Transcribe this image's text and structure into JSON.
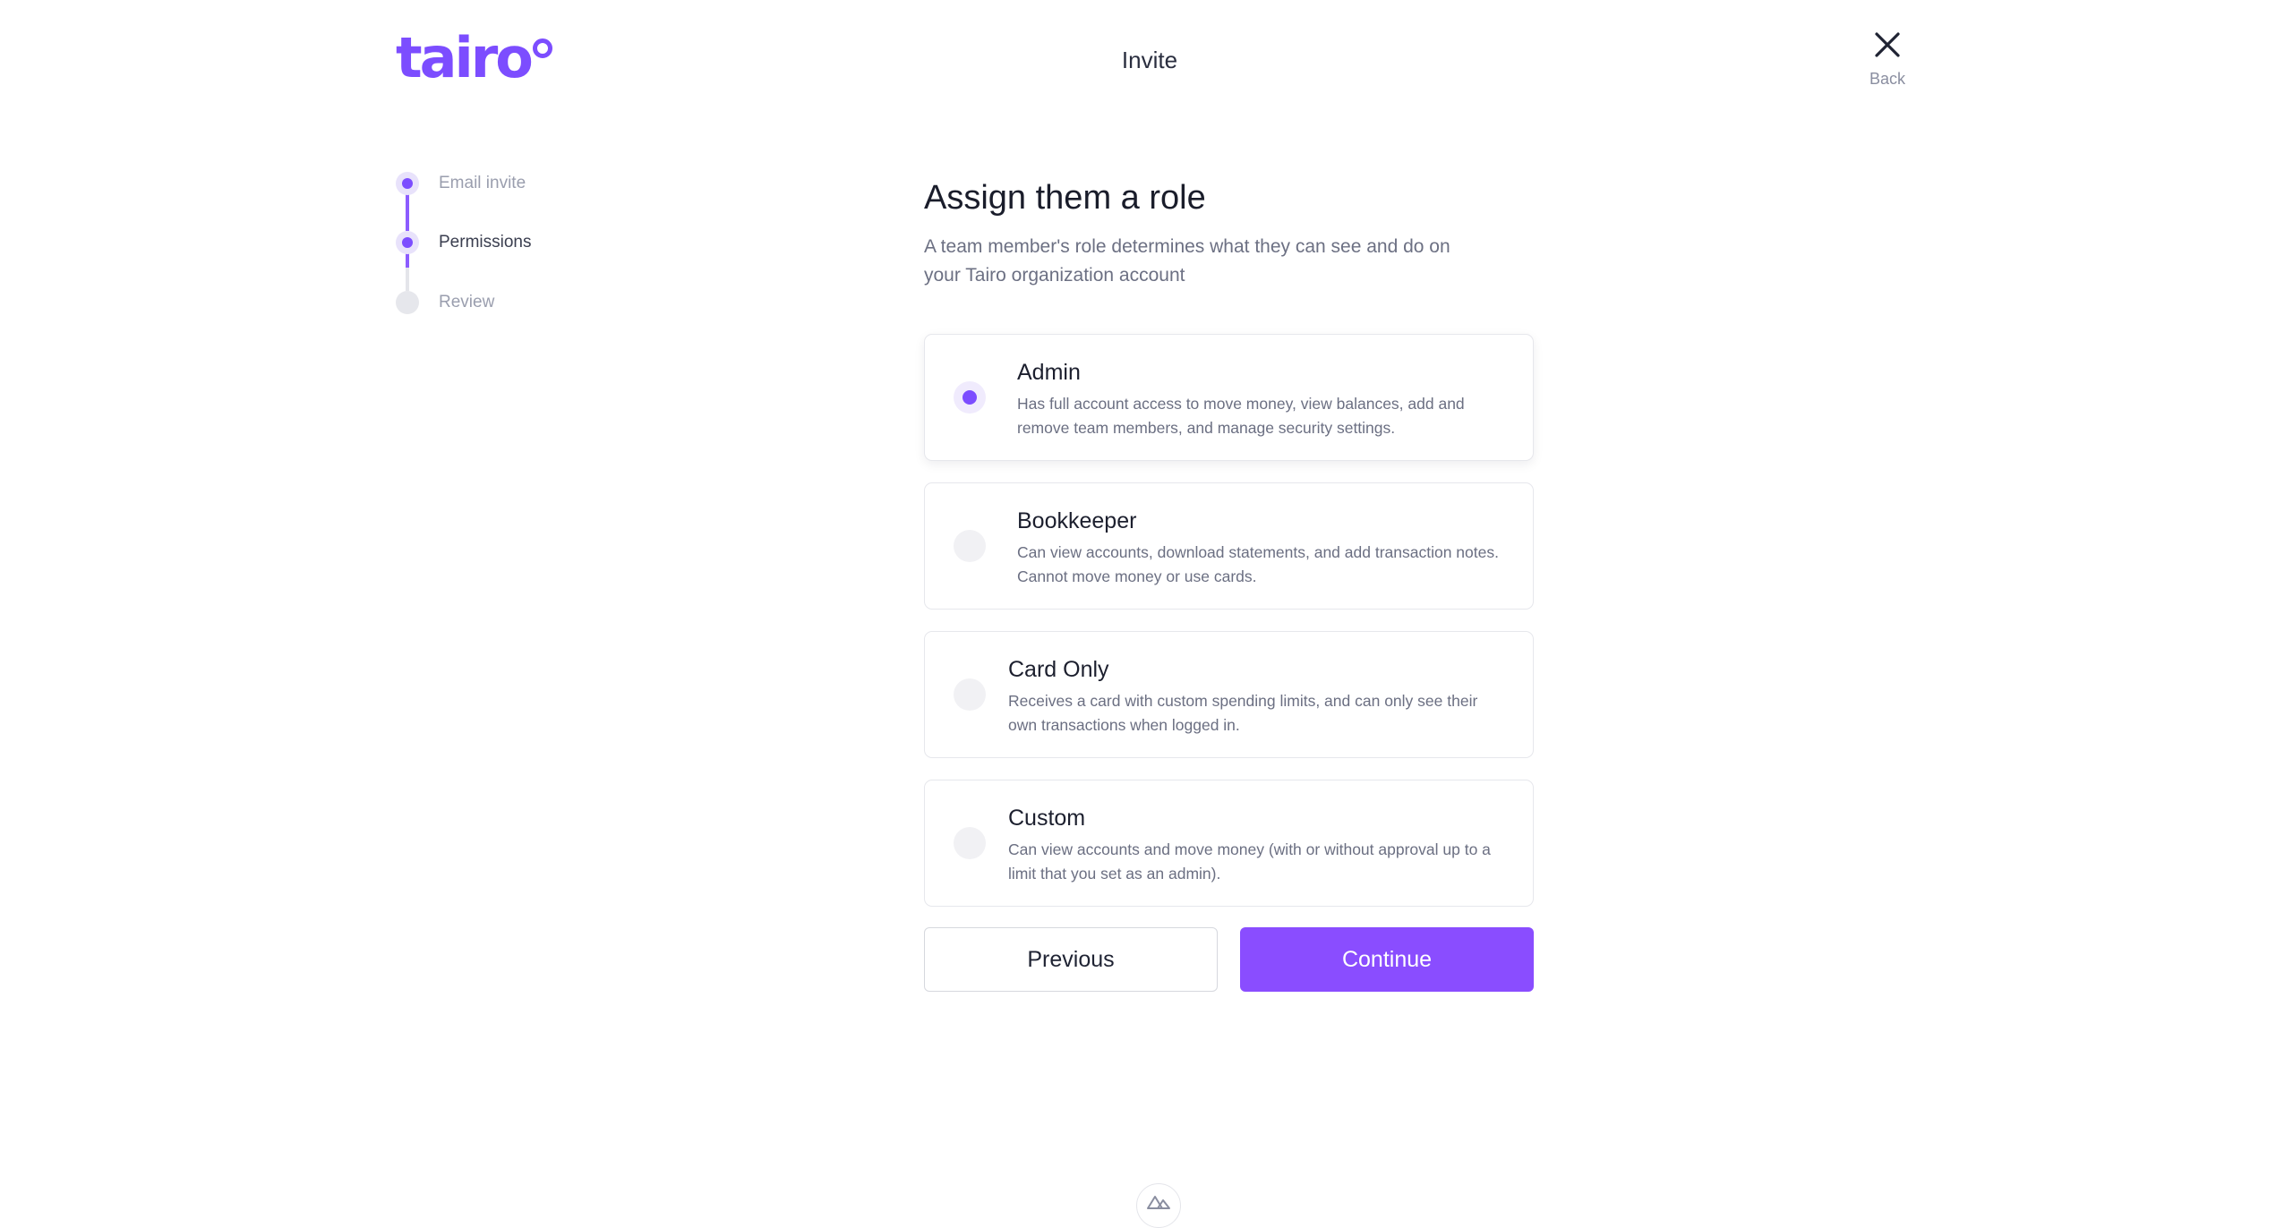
{
  "header": {
    "logo_text": "tairo",
    "title": "Invite",
    "back_label": "Back",
    "back_icon": "close-icon"
  },
  "stepper": {
    "steps": [
      {
        "label": "Email invite",
        "state": "done"
      },
      {
        "label": "Permissions",
        "state": "current"
      },
      {
        "label": "Review",
        "state": "upcoming"
      }
    ]
  },
  "main": {
    "title": "Assign them a role",
    "subtitle": "A team member's role determines what they can see and do on your Tairo organization account"
  },
  "roles": [
    {
      "name": "Admin",
      "description": "Has full account access to move money, view balances, add and remove team members, and manage security settings.",
      "selected": true
    },
    {
      "name": "Bookkeeper",
      "description": "Can view accounts, download statements, and add transaction notes. Cannot move money or use cards.",
      "selected": false
    },
    {
      "name": "Card Only",
      "description": "Receives a card with custom spending limits, and can only see their own transactions when logged in.",
      "selected": false
    },
    {
      "name": "Custom",
      "description": "Can view accounts and move money (with or without approval up to a limit that you set as an admin).",
      "selected": false
    }
  ],
  "actions": {
    "previous_label": "Previous",
    "continue_label": "Continue"
  },
  "footer": {
    "badge_icon": "nuxt-logo-icon"
  },
  "colors": {
    "accent": "#7c4dff",
    "button_primary": "#8a4dff",
    "text_muted": "#6c7083"
  }
}
